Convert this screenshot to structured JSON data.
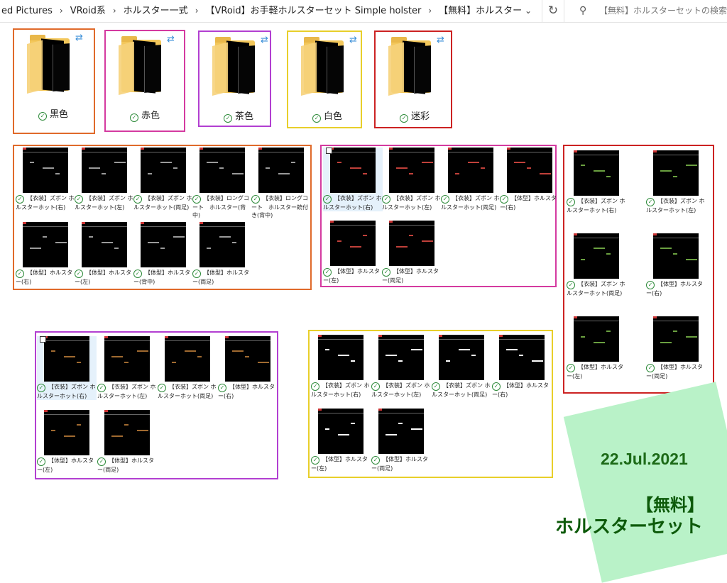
{
  "address_bar": {
    "crumbs": [
      "ed Pictures",
      "VRoid系",
      "ホルスター一式",
      "【VRoid】お手軽ホルスターセット Simple holster",
      "【無料】ホルスターセット"
    ],
    "search_placeholder": "【無料】ホルスターセットの検索"
  },
  "folders": [
    {
      "label": "黒色",
      "frame_color": "#e06a2a"
    },
    {
      "label": "赤色",
      "frame_color": "#d43aa0"
    },
    {
      "label": "茶色",
      "frame_color": "#b23fd1"
    },
    {
      "label": "白色",
      "frame_color": "#e8cf2a"
    },
    {
      "label": "迷彩",
      "frame_color": "#cc2222"
    }
  ],
  "groups": [
    {
      "name": "黒色",
      "frame_color": "#e06a2a",
      "mark_color": "#9a9a9a",
      "items": [
        "【衣装】ズボン ホルスターホット(右)",
        "【衣装】ズボン ホルスターホット(左)",
        "【衣装】ズボン ホルスターホット(両足)",
        "【衣装】ロングコート　ホルスター(背中)",
        "【衣装】ロングコート　ホルスター銃付き(背中)",
        "【体型】ホルスター(右)",
        "【体型】ホルスター(左)",
        "【体型】ホルスター(背中)",
        "【体型】ホルスター(両足)"
      ]
    },
    {
      "name": "赤色",
      "frame_color": "#d43aa0",
      "mark_color": "#c0403a",
      "items": [
        "【衣装】ズボン ホルスターホット(右)",
        "【衣装】ズボン ホルスターホット(左)",
        "【衣装】ズボン ホルスターホット(両足)",
        "【体型】ホルスター(右)",
        "【体型】ホルスター(左)",
        "【体型】ホルスター(両足)"
      ]
    },
    {
      "name": "迷彩",
      "frame_color": "#cc2222",
      "mark_color": "#6aa040",
      "items": [
        "【衣装】ズボン ホルスターホット(右)",
        "【衣装】ズボン ホルスターホット(左)",
        "【衣装】ズボン ホルスターホット(両足)",
        "【体型】ホルスター(右)",
        "【体型】ホルスター(左)",
        "【体型】ホルスター(両足)"
      ]
    },
    {
      "name": "茶色",
      "frame_color": "#b23fd1",
      "mark_color": "#a06a30",
      "items": [
        "【衣装】ズボン ホルスターホット(右)",
        "【衣装】ズボン ホルスターホット(左)",
        "【衣装】ズボン ホルスターホット(両足)",
        "【体型】ホルスター(右)",
        "【体型】ホルスター(左)",
        "【体型】ホルスター(両足)"
      ]
    },
    {
      "name": "白色",
      "frame_color": "#e8cf2a",
      "mark_color": "#ffffff",
      "items": [
        "【衣装】ズボン ホルスターホット(右)",
        "【衣装】ズボン ホルスターホット(左)",
        "【衣装】ズボン ホルスターホット(両足)",
        "【体型】ホルスター(右)",
        "【体型】ホルスター(左)",
        "【体型】ホルスター(両足)"
      ]
    }
  ],
  "note": {
    "date": "22.Jul.2021",
    "line1": "【無料】",
    "line2": "ホルスターセット"
  }
}
